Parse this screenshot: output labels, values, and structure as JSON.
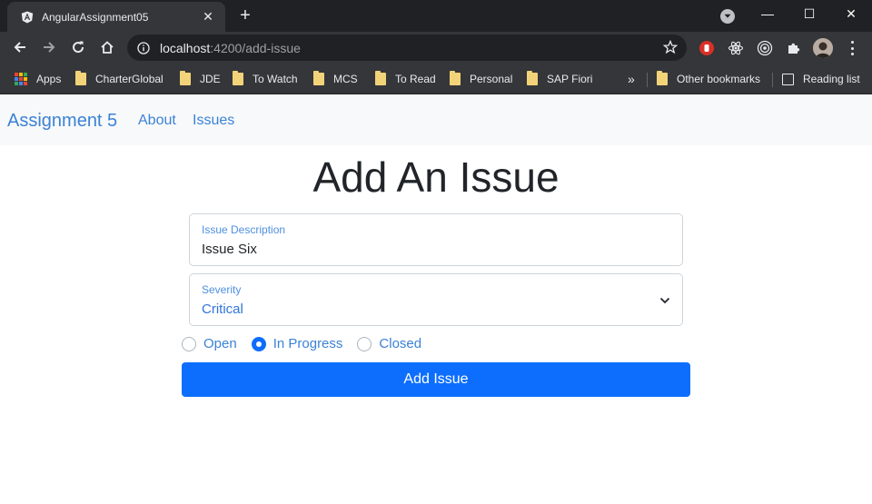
{
  "browser": {
    "tab": {
      "title": "AngularAssignment05",
      "close_glyph": "✕",
      "favicon": "angular-icon"
    },
    "new_tab_glyph": "+",
    "window_controls": {
      "minimize": "—",
      "maximize": "☐",
      "close": "✕"
    },
    "address_bar": {
      "host": "localhost",
      "path": ":4200/add-issue"
    },
    "bookmarks": {
      "apps_label": "Apps",
      "items": [
        "CharterGlobal",
        "JDE",
        "To Watch",
        "MCS",
        "To Read",
        "Personal",
        "SAP Fiori"
      ],
      "overflow_glyph": "»",
      "other_bookmarks": "Other bookmarks",
      "reading_list": "Reading list"
    }
  },
  "app": {
    "navbar": {
      "brand": "Assignment 5",
      "links": [
        "About",
        "Issues"
      ]
    },
    "heading": "Add An Issue",
    "form": {
      "description": {
        "label": "Issue Description",
        "value": "Issue Six"
      },
      "severity": {
        "label": "Severity",
        "value": "Critical"
      },
      "status": {
        "options": [
          {
            "label": "Open",
            "checked": false
          },
          {
            "label": "In Progress",
            "checked": true
          },
          {
            "label": "Closed",
            "checked": false
          }
        ]
      },
      "submit_label": "Add Issue"
    }
  },
  "colors": {
    "primary": "#0d6efd",
    "link": "#3b82d6",
    "navbar_bg": "#f8f9fa",
    "chrome_dark": "#202124",
    "chrome_toolbar": "#35363a"
  }
}
